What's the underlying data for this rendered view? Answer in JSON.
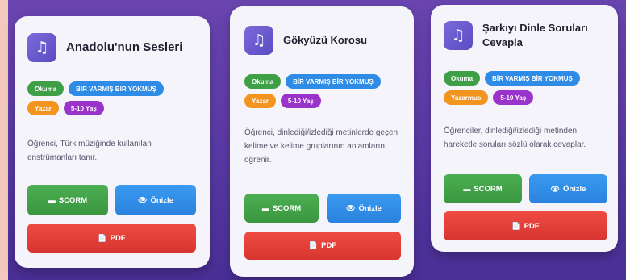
{
  "cards": [
    {
      "logo_icon": "music-book-icon",
      "title": "Anadolu'nun Sesleri",
      "tags": [
        "Okuma",
        "BİR VARMIŞ BİR YOKMUŞ",
        "Yazar",
        "5-10 Yaş"
      ],
      "description": "Öğrenci, Türk müziğinde kullanılan enstrümanları tanır.",
      "buttons": {
        "scorm": "SCORM",
        "preview": "Önizle",
        "pdf": "PDF"
      },
      "icons": {
        "scorm": "▬",
        "preview": "👁",
        "pdf": "📄"
      }
    },
    {
      "logo_icon": "music-book-icon",
      "title": "Gökyüzü Korosu",
      "tags": [
        "Okuma",
        "BİR VARMIŞ BİR YOKMUŞ",
        "Yazar",
        "5-10 Yaş"
      ],
      "description": "Öğrenci, dinlediği/izlediği metinlerde geçen kelime ve kelime gruplarının anlamlarını öğrenir.",
      "buttons": {
        "scorm": "SCORM",
        "preview": "Önizle",
        "pdf": "PDF"
      },
      "icons": {
        "scorm": "▬",
        "preview": "👁",
        "pdf": "📄"
      }
    },
    {
      "logo_icon": "music-book-icon",
      "title": "Şarkıyı Dinle Soruları Cevapla",
      "tags": [
        "Okuma",
        "BİR VARMIŞ BİR YOKMUŞ",
        "Yazarmus",
        "5-10 Yaş"
      ],
      "description": "Öğrenciler, dinlediği/izlediği metinden hareketle soruları sözlü olarak cevaplar.",
      "buttons": {
        "scorm": "SCORM",
        "preview": "Önizle",
        "pdf": "PDF"
      },
      "icons": {
        "scorm": "▬",
        "preview": "👁",
        "pdf": "📄"
      }
    }
  ],
  "colors": {
    "green": "#3f9f46",
    "blue": "#2e8be6",
    "orange": "#f3941f",
    "purple": "#9a33c9",
    "red": "#e3403a",
    "background": "#5a3aa6"
  }
}
